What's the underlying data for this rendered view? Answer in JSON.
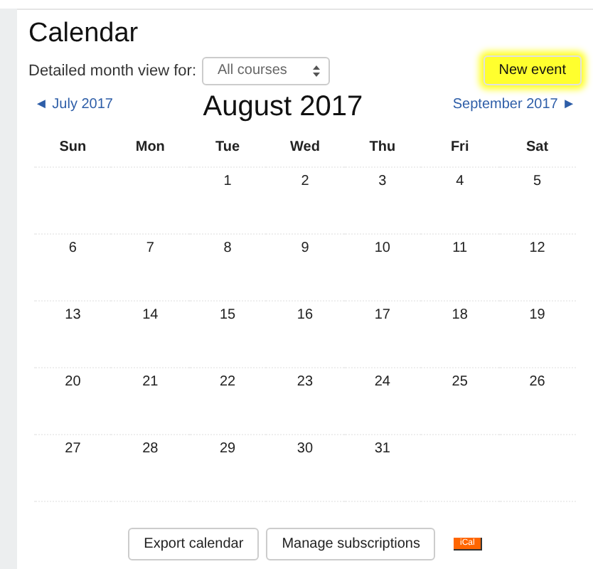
{
  "title": "Calendar",
  "filter": {
    "label": "Detailed month view for:",
    "value": "All courses"
  },
  "new_event": {
    "label": "New event",
    "highlighted": true
  },
  "nav": {
    "prev": "◄ July 2017",
    "month": "August 2017",
    "next": "September 2017 ►"
  },
  "weekdays": [
    "Sun",
    "Mon",
    "Tue",
    "Wed",
    "Thu",
    "Fri",
    "Sat"
  ],
  "weeks": [
    {
      "kind": "first",
      "days": [
        "1",
        "2",
        "3",
        "4",
        "5"
      ]
    },
    {
      "kind": "full",
      "days": [
        "6",
        "7",
        "8",
        "9",
        "10",
        "11",
        "12"
      ]
    },
    {
      "kind": "full",
      "days": [
        "13",
        "14",
        "15",
        "16",
        "17",
        "18",
        "19"
      ]
    },
    {
      "kind": "full",
      "days": [
        "20",
        "21",
        "22",
        "23",
        "24",
        "25",
        "26"
      ]
    },
    {
      "kind": "last",
      "days": [
        "27",
        "28",
        "29",
        "30",
        "31"
      ]
    }
  ],
  "buttons": [
    "Export calendar",
    "Manage subscriptions"
  ],
  "ical": "iCal"
}
